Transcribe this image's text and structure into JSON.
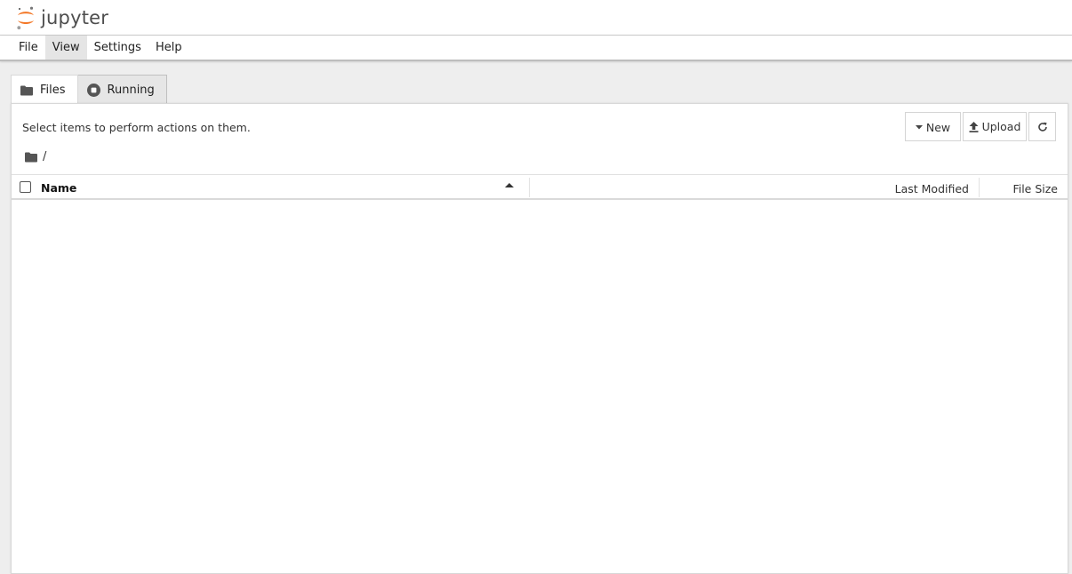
{
  "app": {
    "logo_text": "jupyter",
    "accent": "#f37726"
  },
  "menu": {
    "items": [
      {
        "label": "File",
        "active": false
      },
      {
        "label": "View",
        "active": true
      },
      {
        "label": "Settings",
        "active": false
      },
      {
        "label": "Help",
        "active": false
      }
    ]
  },
  "tabs": [
    {
      "label": "Files",
      "icon": "folder-icon",
      "active": true
    },
    {
      "label": "Running",
      "icon": "stop-circle-icon",
      "active": false
    }
  ],
  "files_panel": {
    "hint": "Select items to perform actions on them.",
    "buttons": {
      "new_label": "New",
      "upload_label": "Upload",
      "refresh_icon": "refresh-icon"
    },
    "breadcrumb": {
      "icon": "folder-icon",
      "path": "/"
    },
    "columns": {
      "name": "Name",
      "last_modified": "Last Modified",
      "file_size": "File Size"
    },
    "sort": "name-ascending",
    "rows": []
  }
}
